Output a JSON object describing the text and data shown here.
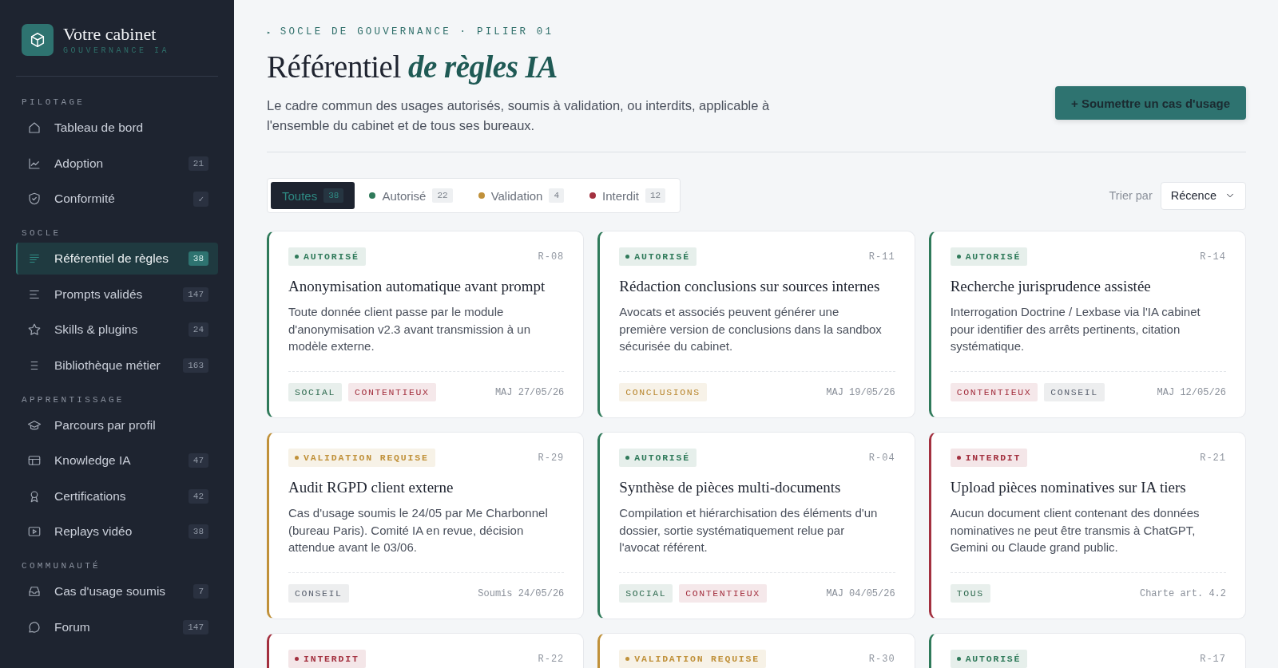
{
  "brand": {
    "name": "Votre cabinet",
    "tagline": "GOUVERNANCE IA"
  },
  "sidebar": {
    "sections": [
      {
        "title": "PILOTAGE",
        "items": [
          {
            "label": "Tableau de bord",
            "selected": false
          },
          {
            "label": "Adoption",
            "badge": "21",
            "selected": false
          },
          {
            "label": "Conformité",
            "badge": "✓",
            "selected": false
          }
        ]
      },
      {
        "title": "SOCLE",
        "items": [
          {
            "label": "Référentiel de règles",
            "badge": "38",
            "selected": true
          },
          {
            "label": "Prompts validés",
            "badge": "147",
            "selected": false
          },
          {
            "label": "Skills & plugins",
            "badge": "24",
            "selected": false
          },
          {
            "label": "Bibliothèque métier",
            "badge": "163",
            "selected": false
          }
        ]
      },
      {
        "title": "APPRENTISSAGE",
        "items": [
          {
            "label": "Parcours par profil",
            "selected": false
          },
          {
            "label": "Knowledge IA",
            "badge": "47",
            "selected": false
          },
          {
            "label": "Certifications",
            "badge": "42",
            "selected": false
          },
          {
            "label": "Replays vidéo",
            "badge": "38",
            "selected": false
          }
        ]
      },
      {
        "title": "COMMUNAUTÉ",
        "items": [
          {
            "label": "Cas d'usage soumis",
            "badge": "7",
            "selected": false
          },
          {
            "label": "Forum",
            "badge": "147",
            "selected": false
          }
        ]
      }
    ]
  },
  "header": {
    "eyebrow_marker": "▸",
    "eyebrow": "SOCLE DE GOUVERNANCE · PILIER 01",
    "title": "Référentiel *de règles IA*",
    "subtitle": "Le cadre commun des usages autorisés, soumis à validation, ou interdits, applicable à l'ensemble du cabinet et de tous ses bureaux.",
    "action": "+ Soumettre un cas d'usage"
  },
  "filters": [
    {
      "label": "Toutes",
      "count": "38",
      "selected": true
    },
    {
      "label": "Autorisé",
      "count": "22",
      "color": "#2f7a5a",
      "selected": false
    },
    {
      "label": "Validation",
      "count": "4",
      "color": "#c0913a",
      "selected": false
    },
    {
      "label": "Interdit",
      "count": "12",
      "color": "#a3303f",
      "selected": false
    }
  ],
  "sort": {
    "label": "Trier par",
    "value": "Récence"
  },
  "rules": [
    {
      "kind": "authorized",
      "status_label": "AUTORISÉ",
      "ref": "R-08",
      "title": "Anonymisation automatique avant prompt",
      "description": "Toute donnée client passe par le module d'anonymisation v2.3 avant transmission à un modèle externe.",
      "tags": [
        {
          "label": "SOCIAL",
          "color": "#2f6b50"
        },
        {
          "label": "CONTENTIEUX",
          "color": "#a3303f"
        }
      ],
      "meta": "MAJ 27/05/26"
    },
    {
      "kind": "authorized",
      "status_label": "AUTORISÉ",
      "ref": "R-11",
      "title": "Rédaction conclusions sur sources internes",
      "description": "Avocats et associés peuvent générer une première version de conclusions dans la sandbox sécurisée du cabinet.",
      "tags": [
        {
          "label": "CONCLUSIONS",
          "color": "#b8862e"
        }
      ],
      "meta": "MAJ 19/05/26"
    },
    {
      "kind": "authorized",
      "status_label": "AUTORISÉ",
      "ref": "R-14",
      "title": "Recherche jurisprudence assistée",
      "description": "Interrogation Doctrine / Lexbase via l'IA cabinet pour identifier des arrêts pertinents, citation systématique.",
      "tags": [
        {
          "label": "CONTENTIEUX",
          "color": "#a3303f"
        },
        {
          "label": "CONSEIL",
          "color": "#5b6270"
        }
      ],
      "meta": "MAJ 12/05/26"
    },
    {
      "kind": "pending",
      "status_label": "VALIDATION REQUISE",
      "ref": "R-29",
      "title": "Audit RGPD client externe",
      "description": "Cas d'usage soumis le 24/05 par Me Charbonnel (bureau Paris). Comité IA en revue, décision attendue avant le 03/06.",
      "tags": [
        {
          "label": "CONSEIL",
          "color": "#5b6270"
        }
      ],
      "meta": "Soumis 24/05/26"
    },
    {
      "kind": "authorized",
      "status_label": "AUTORISÉ",
      "ref": "R-04",
      "title": "Synthèse de pièces multi-documents",
      "description": "Compilation et hiérarchisation des éléments d'un dossier, sortie systématiquement relue par l'avocat référent.",
      "tags": [
        {
          "label": "SOCIAL",
          "color": "#2f6b50"
        },
        {
          "label": "CONTENTIEUX",
          "color": "#a3303f"
        }
      ],
      "meta": "MAJ 04/05/26"
    },
    {
      "kind": "forbidden",
      "status_label": "INTERDIT",
      "ref": "R-21",
      "title": "Upload pièces nominatives sur IA tiers",
      "description": "Aucun document client contenant des données nominatives ne peut être transmis à ChatGPT, Gemini ou Claude grand public.",
      "tags": [
        {
          "label": "TOUS",
          "color": "#2f6b50"
        }
      ],
      "meta": "Charte art. 4.2"
    },
    {
      "kind": "forbidden",
      "status_label": "INTERDIT",
      "ref": "R-22"
    },
    {
      "kind": "pending",
      "status_label": "VALIDATION REQUISE",
      "ref": "R-30"
    },
    {
      "kind": "authorized",
      "status_label": "AUTORISÉ",
      "ref": "R-17"
    }
  ]
}
